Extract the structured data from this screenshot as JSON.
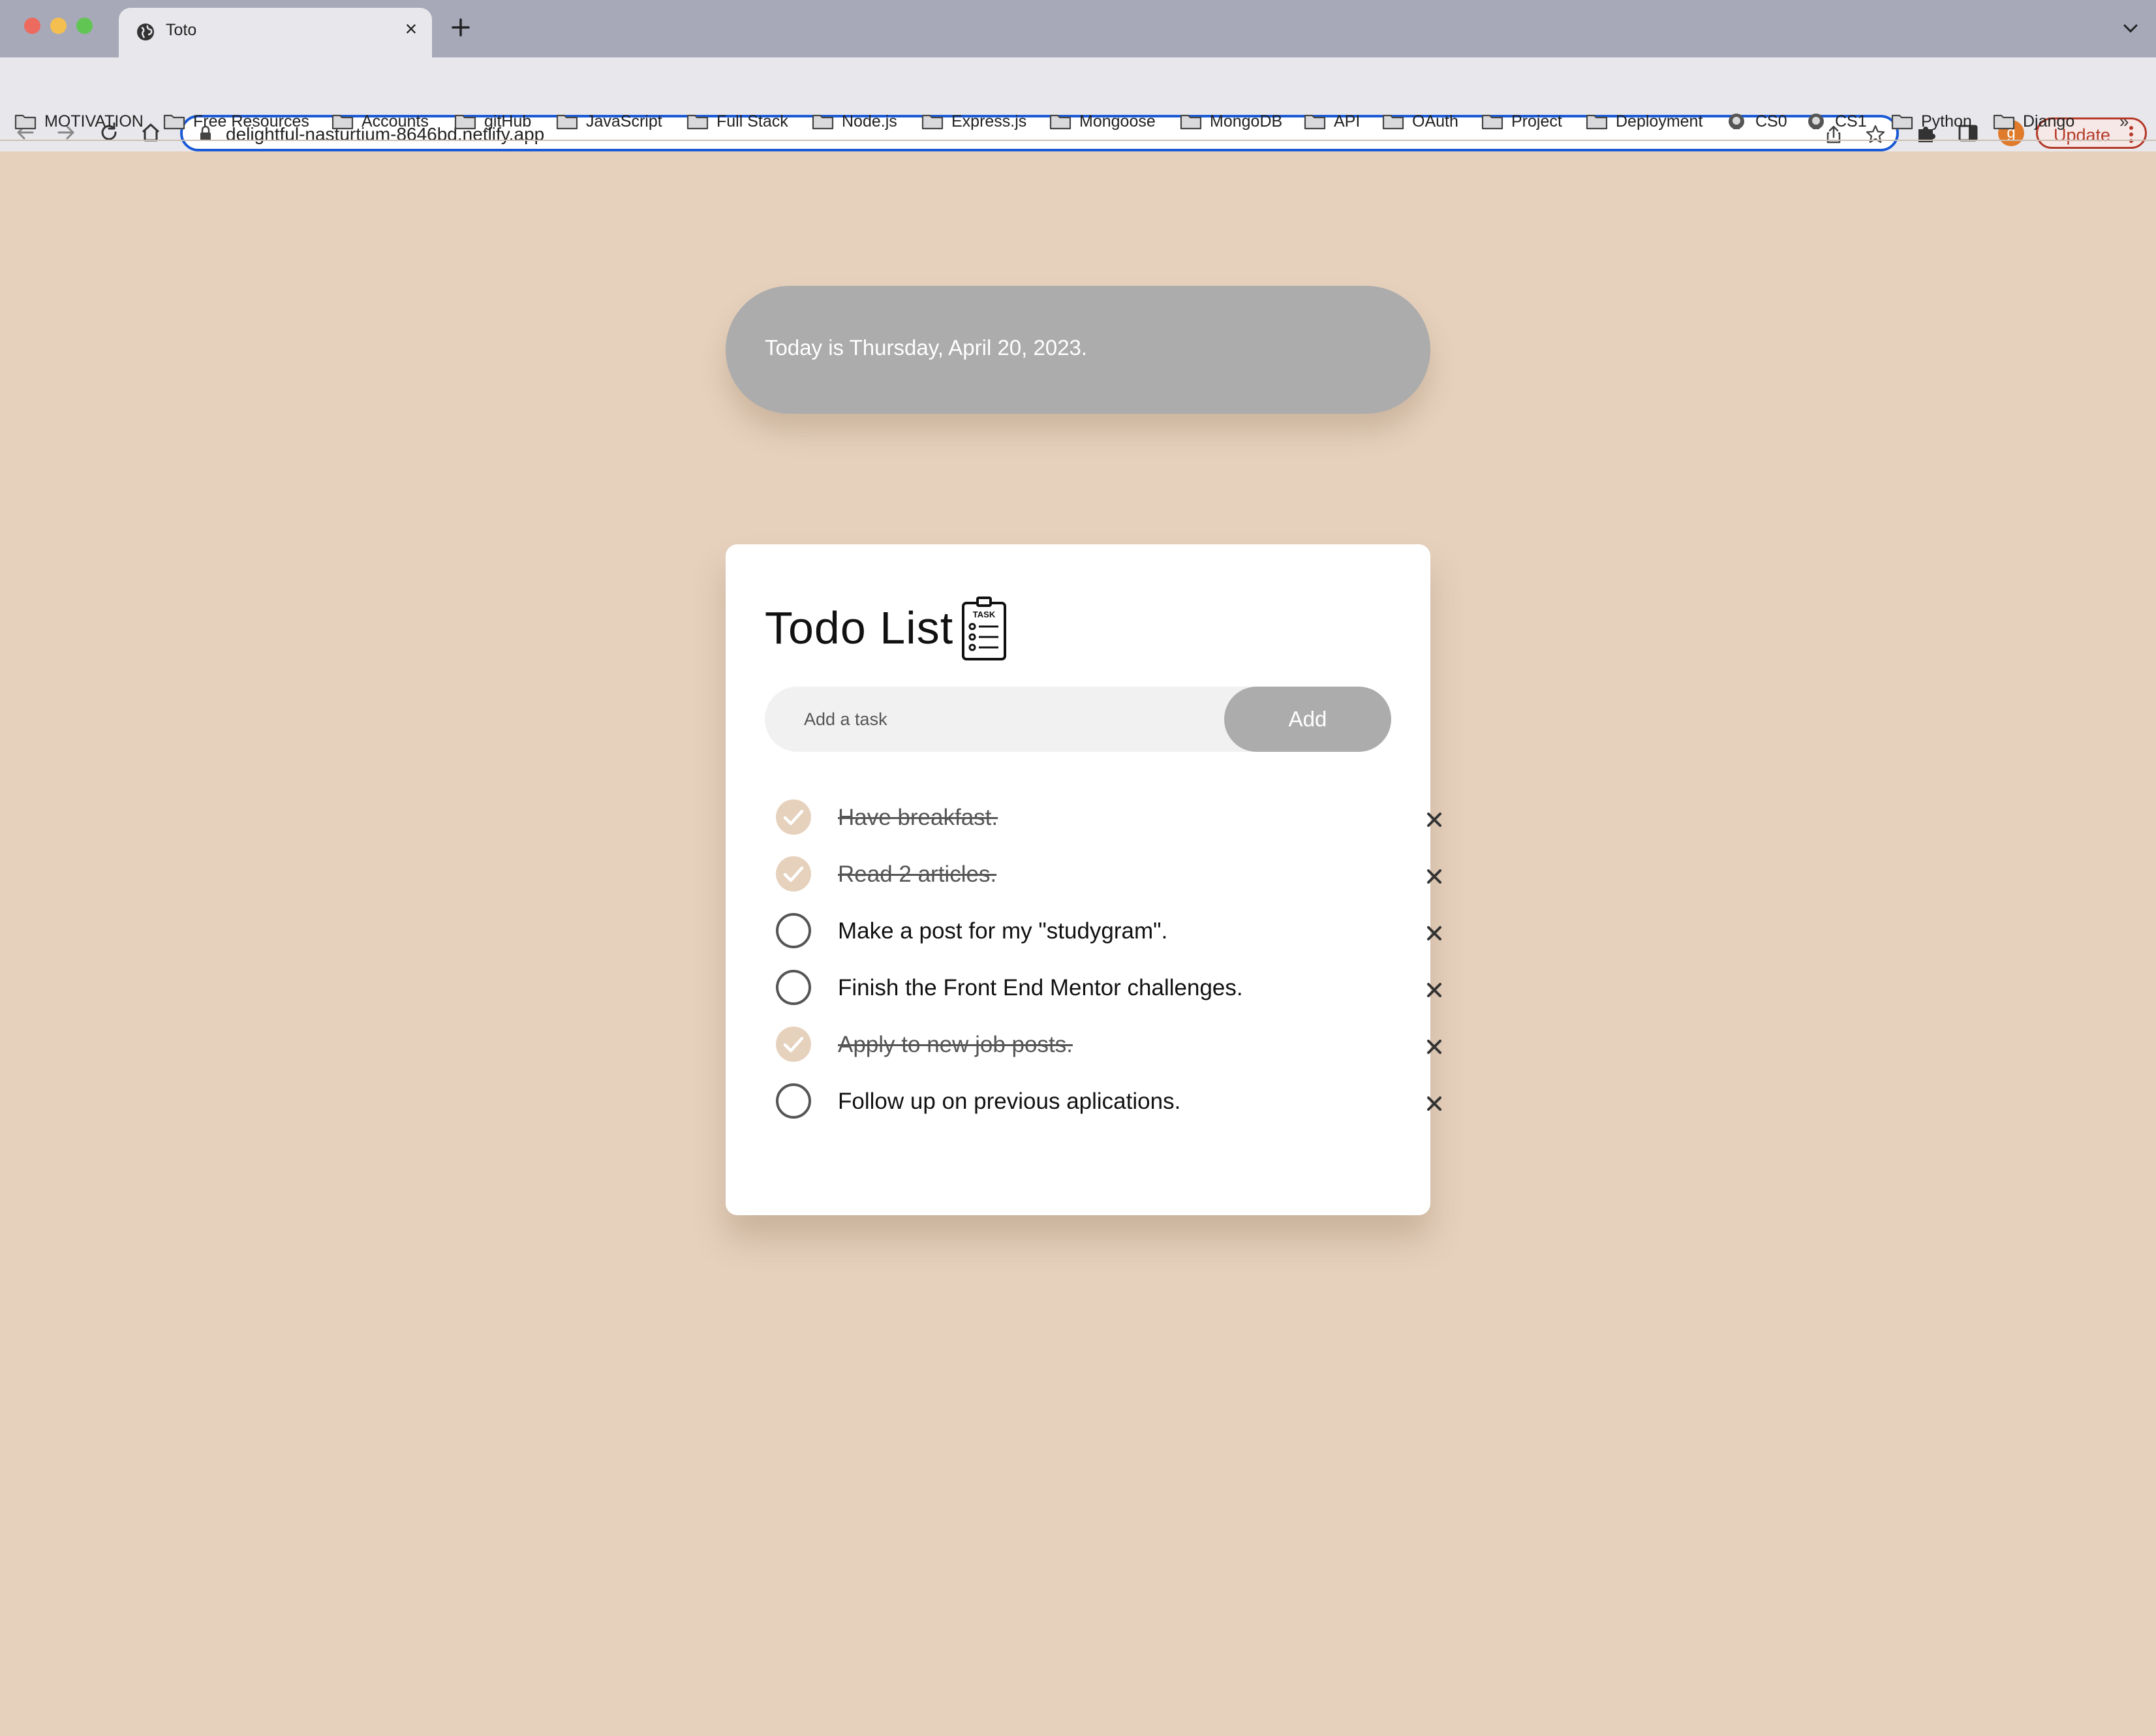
{
  "browser": {
    "tab_title": "Toto",
    "url": "delightful-nasturtium-8646bd.netlify.app",
    "avatar_initial": "g",
    "update_label": "Update",
    "bookmarks": [
      {
        "label": "MOTIVATION",
        "icon": "folder-icon"
      },
      {
        "label": "Free Resources",
        "icon": "folder-icon"
      },
      {
        "label": "Accounts",
        "icon": "folder-icon"
      },
      {
        "label": "gitHub",
        "icon": "folder-icon"
      },
      {
        "label": "JavaScript",
        "icon": "folder-icon"
      },
      {
        "label": "Full Stack",
        "icon": "folder-icon"
      },
      {
        "label": "Node.js",
        "icon": "folder-icon"
      },
      {
        "label": "Express.js",
        "icon": "folder-icon"
      },
      {
        "label": "Mongoose",
        "icon": "folder-icon"
      },
      {
        "label": "MongoDB",
        "icon": "folder-icon"
      },
      {
        "label": "API",
        "icon": "folder-icon"
      },
      {
        "label": "OAuth",
        "icon": "folder-icon"
      },
      {
        "label": "Project",
        "icon": "folder-icon"
      },
      {
        "label": "Deployment",
        "icon": "folder-icon"
      },
      {
        "label": "CS0",
        "icon": "github-icon"
      },
      {
        "label": "CS1",
        "icon": "github-icon"
      },
      {
        "label": "Python",
        "icon": "folder-icon"
      },
      {
        "label": "Django",
        "icon": "folder-icon"
      }
    ],
    "bookmarks_more": "»"
  },
  "page": {
    "date_text": "Today is Thursday, April 20, 2023.",
    "title": "Todo List",
    "input_placeholder": "Add a task",
    "add_label": "Add",
    "tasks": [
      {
        "text": "Have breakfast.",
        "done": true
      },
      {
        "text": "Read 2 articles.",
        "done": true
      },
      {
        "text": "Make a post for my \"studygram\".",
        "done": false
      },
      {
        "text": "Finish the Front End Mentor challenges.",
        "done": false
      },
      {
        "text": "Apply to new job posts.",
        "done": true
      },
      {
        "text": "Follow up on previous aplications.",
        "done": false
      }
    ]
  },
  "colors": {
    "page_background": "#e6d1bd",
    "pill_background": "#acacac",
    "done_check": "#e6d1bd",
    "omnibox_focus": "#1a5ad6"
  }
}
